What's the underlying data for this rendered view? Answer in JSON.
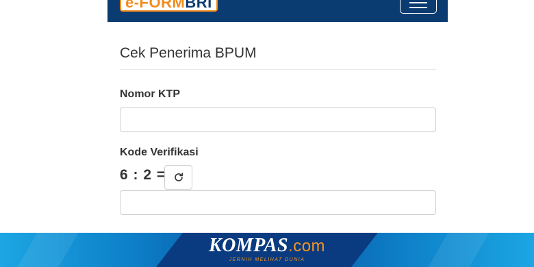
{
  "navbar": {
    "logo_prefix": "e-FORM",
    "logo_brand": "BRI",
    "menu_icon": "hamburger-icon"
  },
  "form": {
    "title": "Cek Penerima BPUM",
    "ktp_label": "Nomor KTP",
    "ktp_value": "",
    "verification_label": "Kode Verifikasi",
    "captcha_text": "6 : 2 =",
    "refresh_icon": "refresh-icon",
    "verification_value": ""
  },
  "footer": {
    "brand": "KOMPAS",
    "brand_suffix": ".com",
    "tagline": "JERNIH MELIHAT DUNIA"
  },
  "colors": {
    "navbar": "#0b3c71",
    "logo_accent": "#f28c1e",
    "banner_dark": "#0a3b80",
    "banner_light": "#1ca6e3",
    "footer_accent": "#f7941d"
  }
}
